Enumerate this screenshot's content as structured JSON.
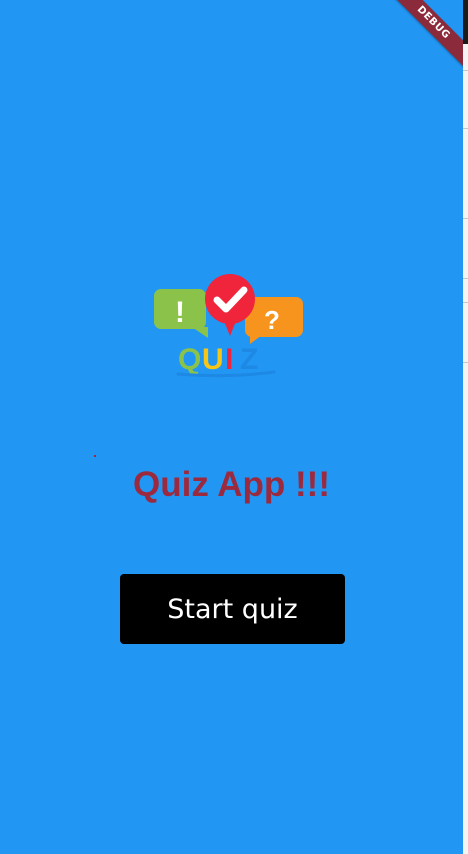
{
  "debug_banner": "DEBUG",
  "logo": {
    "icon_name": "quiz-logo-icon",
    "exclamation": "!",
    "question": "?",
    "letters": [
      "Q",
      "U",
      "I",
      "Z"
    ],
    "colors": {
      "green": "#8bc34a",
      "red": "#f0243a",
      "orange": "#f7941d",
      "blue": "#1e88e5",
      "yellow": "#f5c518"
    }
  },
  "title": "Quiz App !!!",
  "start_button_label": "Start quiz",
  "colors": {
    "background": "#2196f3",
    "title": "#9c2a3f",
    "button": "#000000",
    "debug_banner": "#8b2a3a"
  }
}
